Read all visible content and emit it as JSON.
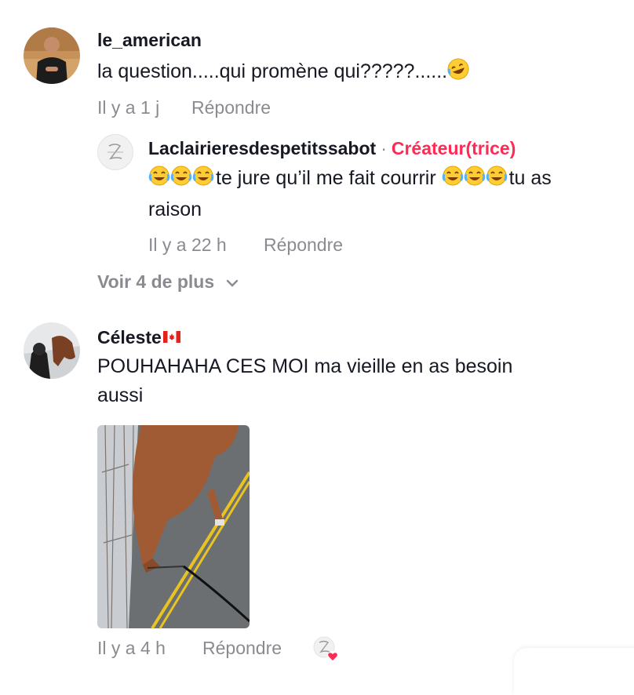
{
  "comments": [
    {
      "username": "le_american",
      "text": "la question.....qui promène qui?????......",
      "text_emoji": "rofl-emoji",
      "time": "Il y a 1 j",
      "reply_label": "Répondre",
      "replies": [
        {
          "username": "Laclairieresdespetitssabot",
          "separator": "·",
          "badge": "Créateur(trice)",
          "text_line1": "te jure qu’il me fait courrir",
          "text_line1_end": "tu as",
          "text_line2": "raison",
          "emoji": "joy-emoji",
          "time": "Il y a 22 h",
          "reply_label": "Répondre"
        }
      ],
      "view_more": "Voir 4 de plus"
    },
    {
      "username": "Céleste",
      "flag": "canada-flag",
      "text_line1": "POUHAHAHA CES MOI ma vieille en as besoin",
      "text_line2": "aussi",
      "attachment": "photo-horse-on-road",
      "time": "Il y a 4 h",
      "reply_label": "Répondre",
      "creator_liked": true
    }
  ],
  "colors": {
    "accent": "#fe2c55",
    "meta": "#8a8b91",
    "text": "#161823"
  }
}
